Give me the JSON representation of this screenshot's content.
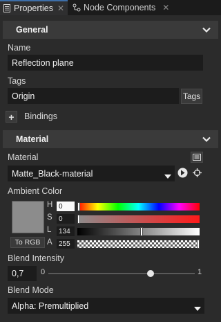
{
  "tabs": [
    {
      "label": "Properties",
      "close": "✕"
    },
    {
      "label": "Node Components",
      "close": "✕"
    }
  ],
  "general": {
    "title": "General",
    "name_label": "Name",
    "name_value": "Reflection plane",
    "tags_label": "Tags",
    "tags_value": "Origin",
    "tags_button": "Tags",
    "bindings_add": "+",
    "bindings_label": "Bindings"
  },
  "material": {
    "title": "Material",
    "material_label": "Material",
    "material_value": "Matte_Black-material",
    "ambient_label": "Ambient Color",
    "swatch_color": "#8c8c8c",
    "to_rgb_button": "To RGB",
    "channels": [
      {
        "label": "H",
        "value": "0",
        "level": 0.0
      },
      {
        "label": "S",
        "value": "0",
        "level": 0.0
      },
      {
        "label": "L",
        "value": "134",
        "level": 0.525
      },
      {
        "label": "A",
        "value": "255",
        "level": 1.0
      }
    ],
    "blend_intensity_label": "Blend Intensity",
    "blend_intensity_value": "0,7",
    "slider_min": "0",
    "slider_max": "1",
    "slider_level": 0.7,
    "blend_mode_label": "Blend Mode",
    "blend_mode_value": "Alpha: Premultiplied"
  },
  "icons": [
    "properties-icon",
    "node-components-icon",
    "chevron-down-icon",
    "dropdown-arrow-icon",
    "reset-icon",
    "target-icon",
    "material-browser-icon"
  ]
}
